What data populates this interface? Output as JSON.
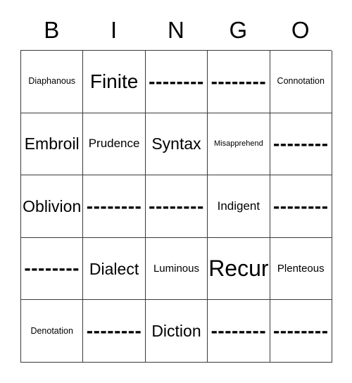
{
  "card": {
    "headers": [
      "B",
      "I",
      "N",
      "G",
      "O"
    ],
    "blank_marker": "--------",
    "rows": [
      [
        {
          "text": "Diaphanous",
          "blank": false,
          "size": "fs-xs"
        },
        {
          "text": "Finite",
          "blank": false,
          "size": "fs-xl"
        },
        {
          "text": "--------",
          "blank": true,
          "size": "fs-xl"
        },
        {
          "text": "--------",
          "blank": true,
          "size": "fs-xl"
        },
        {
          "text": "Connotation",
          "blank": false,
          "size": "fs-xs"
        }
      ],
      [
        {
          "text": "Embroil",
          "blank": false,
          "size": "fs-l"
        },
        {
          "text": "Prudence",
          "blank": false,
          "size": "fs-m"
        },
        {
          "text": "Syntax",
          "blank": false,
          "size": "fs-l"
        },
        {
          "text": "Misapprehend",
          "blank": false,
          "size": "fs-xxs"
        },
        {
          "text": "--------",
          "blank": true,
          "size": "fs-xl"
        }
      ],
      [
        {
          "text": "Oblivion",
          "blank": false,
          "size": "fs-l"
        },
        {
          "text": "--------",
          "blank": true,
          "size": "fs-xl"
        },
        {
          "text": "--------",
          "blank": true,
          "size": "fs-xl"
        },
        {
          "text": "Indigent",
          "blank": false,
          "size": "fs-m"
        },
        {
          "text": "--------",
          "blank": true,
          "size": "fs-xl"
        }
      ],
      [
        {
          "text": "--------",
          "blank": true,
          "size": "fs-xl"
        },
        {
          "text": "Dialect",
          "blank": false,
          "size": "fs-l"
        },
        {
          "text": "Luminous",
          "blank": false,
          "size": "fs-s"
        },
        {
          "text": "Recur",
          "blank": false,
          "size": "fs-xxl"
        },
        {
          "text": "Plenteous",
          "blank": false,
          "size": "fs-s"
        }
      ],
      [
        {
          "text": "Denotation",
          "blank": false,
          "size": "fs-xs"
        },
        {
          "text": "--------",
          "blank": true,
          "size": "fs-xl"
        },
        {
          "text": "Diction",
          "blank": false,
          "size": "fs-l"
        },
        {
          "text": "--------",
          "blank": true,
          "size": "fs-xl"
        },
        {
          "text": "--------",
          "blank": true,
          "size": "fs-xl"
        }
      ]
    ]
  },
  "colors": {
    "border": "#3a3a3a",
    "text": "#000000",
    "background": "#ffffff"
  }
}
